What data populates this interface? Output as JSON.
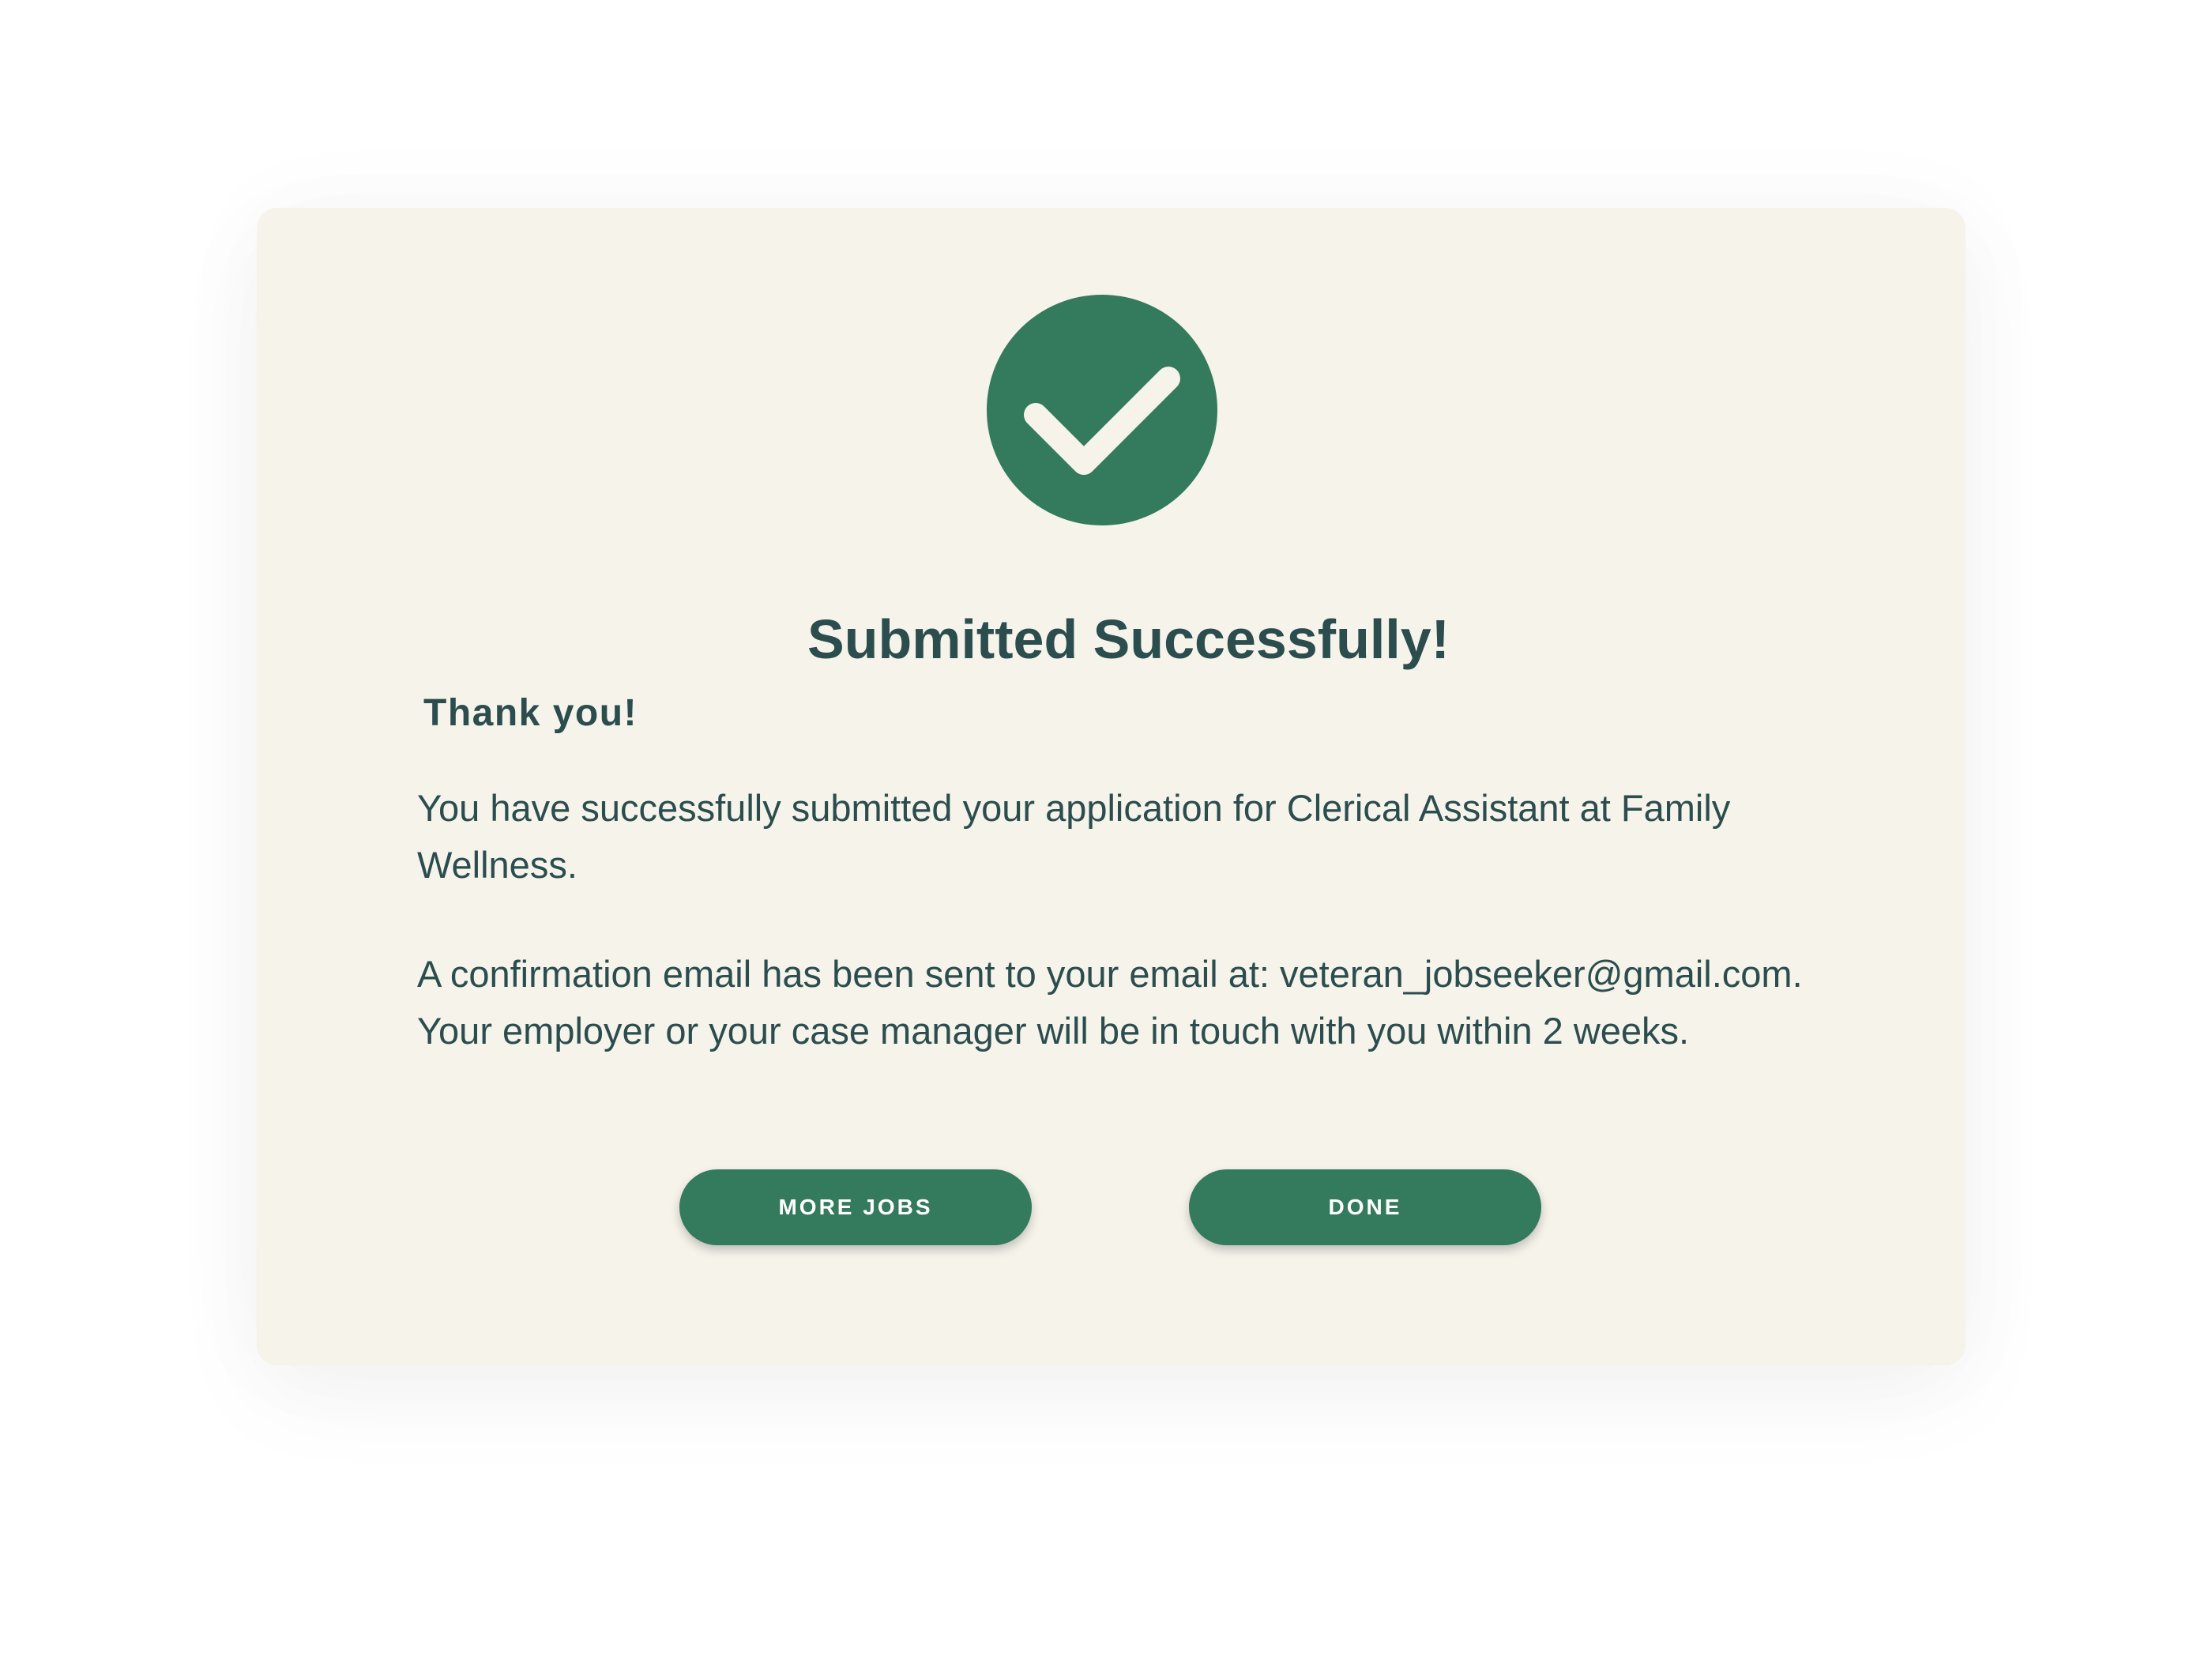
{
  "dialog": {
    "icon": "check-circle-icon",
    "title": "Submitted Successfully!",
    "subtitle": "Thank you!",
    "message_1": "You have successfully submitted your application for Clerical Assistant at Family Wellness.",
    "message_2": "A confirmation email has been sent to your email at: veteran_jobseeker@gmail.com. Your employer or your case manager will be in touch with you within 2 weeks.",
    "buttons": {
      "more_jobs": "MORE JOBS",
      "done": "DONE"
    }
  },
  "colors": {
    "accent": "#347a5c",
    "text": "#2b4d4e",
    "card_background": "#f6f3eb",
    "page_background": "#ffffff"
  }
}
